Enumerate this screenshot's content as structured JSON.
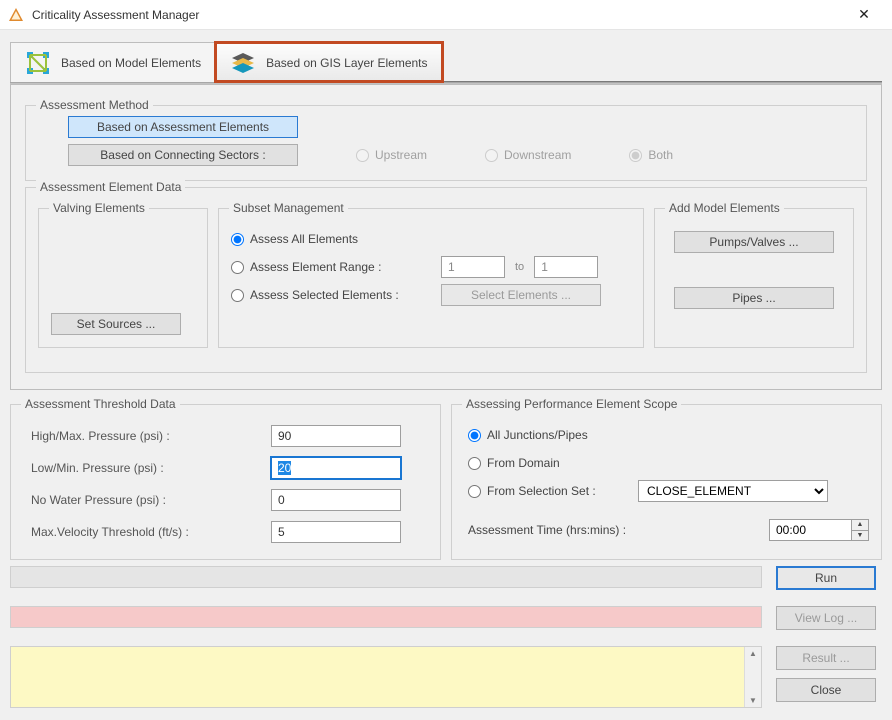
{
  "window": {
    "title": "Criticality Assessment Manager",
    "close_glyph": "✕"
  },
  "tabs": {
    "model": "Based on Model Elements",
    "gis": "Based on GIS Layer Elements"
  },
  "assessment_method": {
    "legend": "Assessment Method",
    "btn_elements": "Based on Assessment Elements",
    "btn_sectors": "Based on Connecting Sectors :",
    "radio_upstream": "Upstream",
    "radio_downstream": "Downstream",
    "radio_both": "Both"
  },
  "element_data": {
    "legend": "Assessment Element Data",
    "valving_legend": "Valving Elements",
    "set_sources": "Set Sources ...",
    "subset": {
      "legend": "Subset Management",
      "r_all": "Assess All Elements",
      "r_range": "Assess Element Range :",
      "r_selected": "Assess Selected Elements :",
      "from": "1",
      "to_label": "to",
      "to": "1",
      "select_btn": "Select Elements ..."
    },
    "add_model": {
      "legend": "Add Model Elements",
      "pumps_btn": "Pumps/Valves ...",
      "pipes_btn": "Pipes ..."
    }
  },
  "threshold": {
    "legend": "Assessment Threshold Data",
    "high_lbl": "High/Max. Pressure (psi) :",
    "high_val": "90",
    "low_lbl": "Low/Min. Pressure (psi) :",
    "low_val": "20",
    "nowater_lbl": "No Water Pressure (psi) :",
    "nowater_val": "0",
    "maxvel_lbl": "Max.Velocity Threshold (ft/s) :",
    "maxvel_val": "5"
  },
  "scope": {
    "legend": "Assessing Performance Element Scope",
    "r_all": "All Junctions/Pipes",
    "r_domain": "From Domain",
    "r_set": "From Selection Set :",
    "set_value": "CLOSE_ELEMENT",
    "time_lbl": "Assessment Time (hrs:mins) :",
    "time_val": "00:00"
  },
  "actions": {
    "run": "Run",
    "viewlog": "View Log ...",
    "result": "Result ...",
    "close": "Close"
  }
}
